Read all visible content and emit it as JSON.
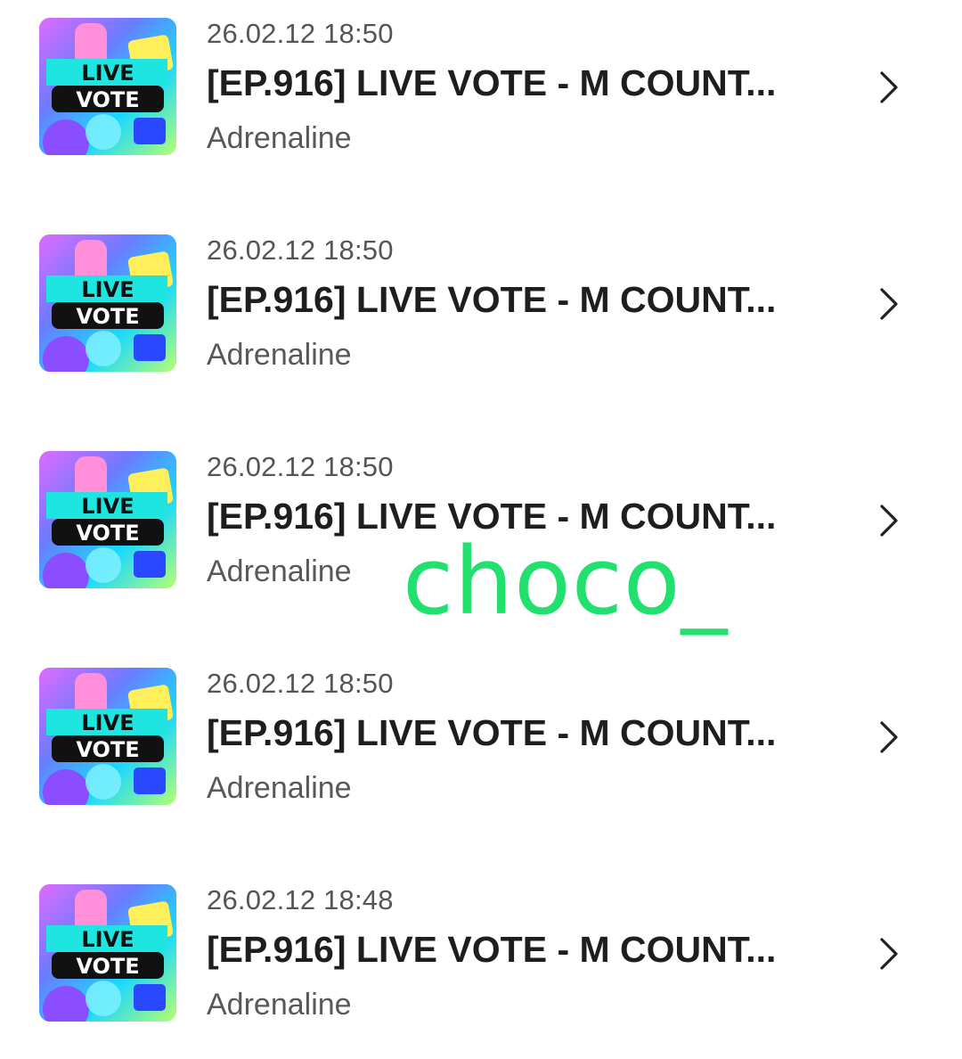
{
  "items": [
    {
      "timestamp": "26.02.12 18:50",
      "title": "[EP.916] LIVE VOTE - M COUNT...",
      "artist": "Adrenaline",
      "thumb_line1": "LIVE",
      "thumb_line2": "VOTE"
    },
    {
      "timestamp": "26.02.12 18:50",
      "title": "[EP.916] LIVE VOTE - M COUNT...",
      "artist": "Adrenaline",
      "thumb_line1": "LIVE",
      "thumb_line2": "VOTE"
    },
    {
      "timestamp": "26.02.12 18:50",
      "title": "[EP.916] LIVE VOTE - M COUNT...",
      "artist": "Adrenaline",
      "thumb_line1": "LIVE",
      "thumb_line2": "VOTE"
    },
    {
      "timestamp": "26.02.12 18:50",
      "title": "[EP.916] LIVE VOTE - M COUNT...",
      "artist": "Adrenaline",
      "thumb_line1": "LIVE",
      "thumb_line2": "VOTE"
    },
    {
      "timestamp": "26.02.12 18:48",
      "title": "[EP.916] LIVE VOTE - M COUNT...",
      "artist": "Adrenaline",
      "thumb_line1": "LIVE",
      "thumb_line2": "VOTE"
    }
  ],
  "watermark": "choco_",
  "colors": {
    "watermark": "#22e06e",
    "title": "#1e1e1e",
    "meta": "#555555"
  }
}
